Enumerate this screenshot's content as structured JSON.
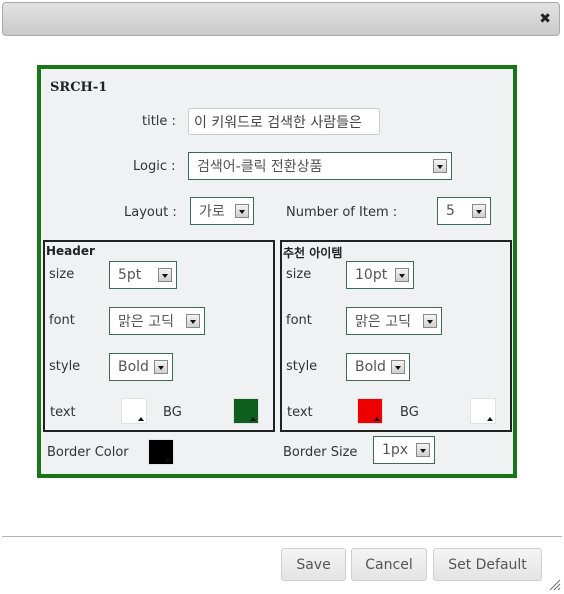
{
  "dialog": {
    "close_icon": "close-icon"
  },
  "panel": {
    "title": "SRCH-1",
    "title_label": "title :",
    "title_value": "이 키워드로 검색한 사람들은",
    "logic_label": "Logic :",
    "logic_value": "검색어-클릭 전환상품",
    "layout_label": "Layout :",
    "layout_value": "가로",
    "num_items_label": "Number of Item :",
    "num_items_value": "5",
    "header": {
      "title": "Header",
      "size_label": "size",
      "size_value": "5pt",
      "font_label": "font",
      "font_value": "맑은 고딕",
      "style_label": "style",
      "style_value": "Bold",
      "text_label": "text",
      "text_color": "#ffffff",
      "bg_label": "BG",
      "bg_color": "#0e5e1e"
    },
    "items": {
      "title": "추천 아이템",
      "size_label": "size",
      "size_value": "10pt",
      "font_label": "font",
      "font_value": "맑은 고딕",
      "style_label": "style",
      "style_value": "Bold",
      "text_label": "text",
      "text_color": "#ee0000",
      "bg_label": "BG",
      "bg_color": "#ffffff"
    },
    "border_color_label": "Border Color",
    "border_color": "#000000",
    "border_size_label": "Border Size",
    "border_size_value": "1px",
    "panel_border_color": "#177717"
  },
  "footer": {
    "save_label": "Save",
    "cancel_label": "Cancel",
    "set_default_label": "Set Default"
  }
}
